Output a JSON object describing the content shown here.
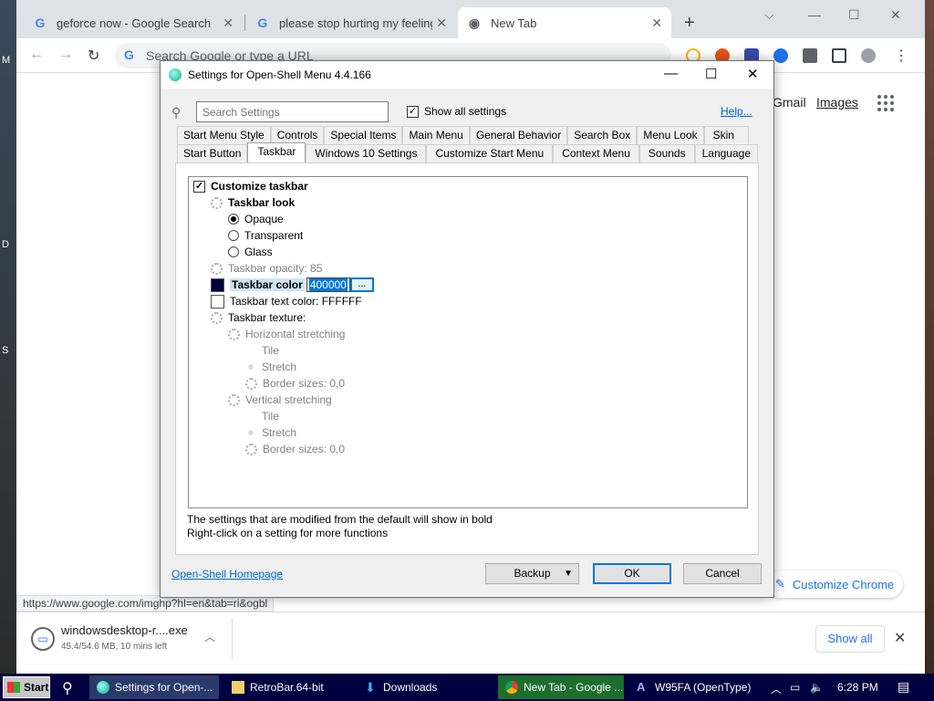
{
  "desktop": {
    "edge_letters": [
      "M",
      "D",
      "S"
    ]
  },
  "chrome": {
    "tabs": [
      {
        "label": "geforce now - Google Search",
        "icon": "google-g-icon"
      },
      {
        "label": "please stop hurting my feelings",
        "icon": "google-g-icon"
      },
      {
        "label": "New Tab",
        "icon": "chrome-icon"
      }
    ],
    "omnibox_placeholder": "Search Google or type a URL",
    "links": {
      "gmail": "Gmail",
      "images": "Images"
    },
    "customize_chrome": "Customize Chrome",
    "status_url": "https://www.google.com/imghp?hl=en&tab=ri&ogbl",
    "download": {
      "file_name": "windowsdesktop-r....exe",
      "status": "45.4/54.6 MB, 10 mins left",
      "show_all": "Show all"
    }
  },
  "dialog": {
    "title": "Settings for Open-Shell Menu 4.4.166",
    "search_placeholder": "Search Settings",
    "show_all_settings": "Show all settings",
    "help": "Help...",
    "tabs_row1": [
      "Start Menu Style",
      "Controls",
      "Special Items",
      "Main Menu",
      "General Behavior",
      "Search Box",
      "Menu Look",
      "Skin"
    ],
    "tabs_row2": [
      "Start Button",
      "Taskbar",
      "Windows 10 Settings",
      "Customize Start Menu",
      "Context Menu",
      "Sounds",
      "Language"
    ],
    "selected_tab": "Taskbar",
    "tree": {
      "customize_taskbar": "Customize taskbar",
      "taskbar_look": "Taskbar look",
      "opaque": "Opaque",
      "transparent": "Transparent",
      "glass": "Glass",
      "taskbar_opacity": "Taskbar opacity: 85",
      "taskbar_color": "Taskbar color",
      "taskbar_color_value": "400000",
      "taskbar_color_button": "...",
      "taskbar_text_color": "Taskbar text color: FFFFFF",
      "taskbar_texture": "Taskbar texture:",
      "horizontal_stretching": "Horizontal stretching",
      "h_tile": "Tile",
      "h_stretch": "Stretch",
      "h_border": "Border sizes: 0,0",
      "vertical_stretching": "Vertical stretching",
      "v_tile": "Tile",
      "v_stretch": "Stretch",
      "v_border": "Border sizes: 0,0"
    },
    "info_line1": "The settings that are modified from the default will show in bold",
    "info_line2": "Right-click on a setting for more functions",
    "homepage": "Open-Shell Homepage",
    "backup": "Backup",
    "ok": "OK",
    "cancel": "Cancel"
  },
  "taskbar": {
    "start": "Start",
    "tasks": [
      {
        "label": "Settings for Open-...",
        "icon": "open-shell-icon"
      },
      {
        "label": "RetroBar.64-bit",
        "icon": "folder-icon"
      },
      {
        "label": "Downloads",
        "icon": "download-arrow-icon"
      },
      {
        "label": "New Tab - Google ...",
        "icon": "chrome-icon"
      },
      {
        "label": "W95FA (OpenType)",
        "icon": "font-icon"
      }
    ],
    "time": "6:28 PM"
  },
  "colors": {
    "taskbar_swatch": "#000040",
    "taskbar_bg": "#000040",
    "link_blue": "#0066cc",
    "chrome_blue": "#1a73e8"
  }
}
